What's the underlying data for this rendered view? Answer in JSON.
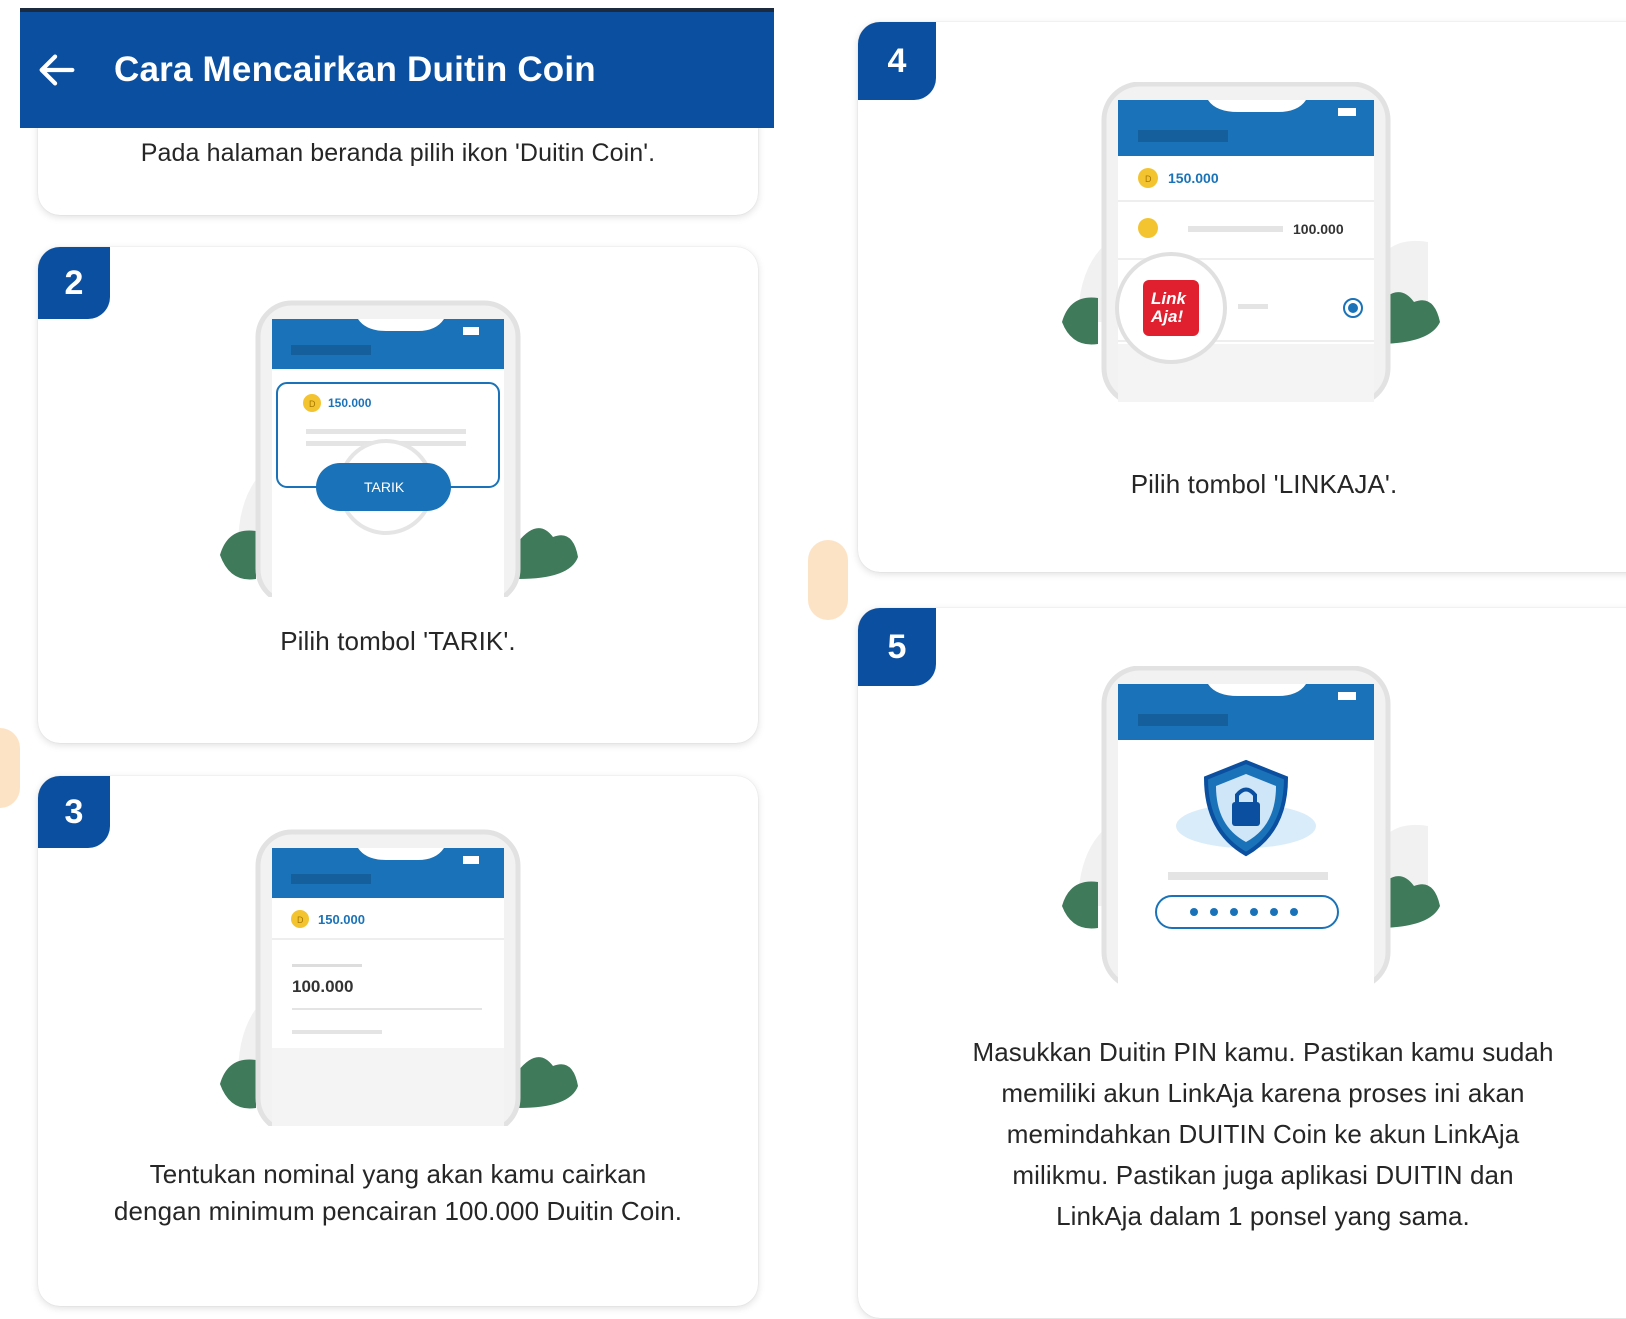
{
  "header": {
    "title": "Cara Mencairkan Duitin Coin"
  },
  "steps": {
    "s1": {
      "caption": "Pada halaman beranda pilih ikon 'Duitin Coin'."
    },
    "s2": {
      "number": "2",
      "caption": "Pilih tombol 'TARIK'.",
      "balance": "150.000",
      "button": "TARIK"
    },
    "s3": {
      "number": "3",
      "caption_line1": "Tentukan nominal yang akan kamu cairkan",
      "caption_line2": "dengan minimum pencairan 100.000 Duitin Coin.",
      "balance": "150.000",
      "amount": "100.000"
    },
    "s4": {
      "number": "4",
      "caption": "Pilih tombol 'LINKAJA'.",
      "balance": "150.000",
      "amount": "100.000",
      "logo_line1": "Link",
      "logo_line2": "Aja!"
    },
    "s5": {
      "number": "5",
      "caption_lines": [
        "Masukkan Duitin PIN kamu. Pastikan kamu sudah",
        "memiliki akun LinkAja karena proses ini akan",
        "memindahkan DUITIN Coin ke akun LinkAja",
        "milikmu. Pastikan juga aplikasi DUITIN dan",
        "LinkAja dalam 1 ponsel yang sama."
      ]
    }
  },
  "colors": {
    "primary": "#0a4fa0",
    "phone_blue": "#1a73b8",
    "coin": "#f4c430",
    "leaf": "#3f7a5a",
    "linkaja_red": "#e0202e"
  },
  "icons": {
    "back": "arrow-left-icon",
    "coin": "coin-icon",
    "shield": "shield-lock-icon",
    "leaf": "plant-leaf-icon"
  }
}
